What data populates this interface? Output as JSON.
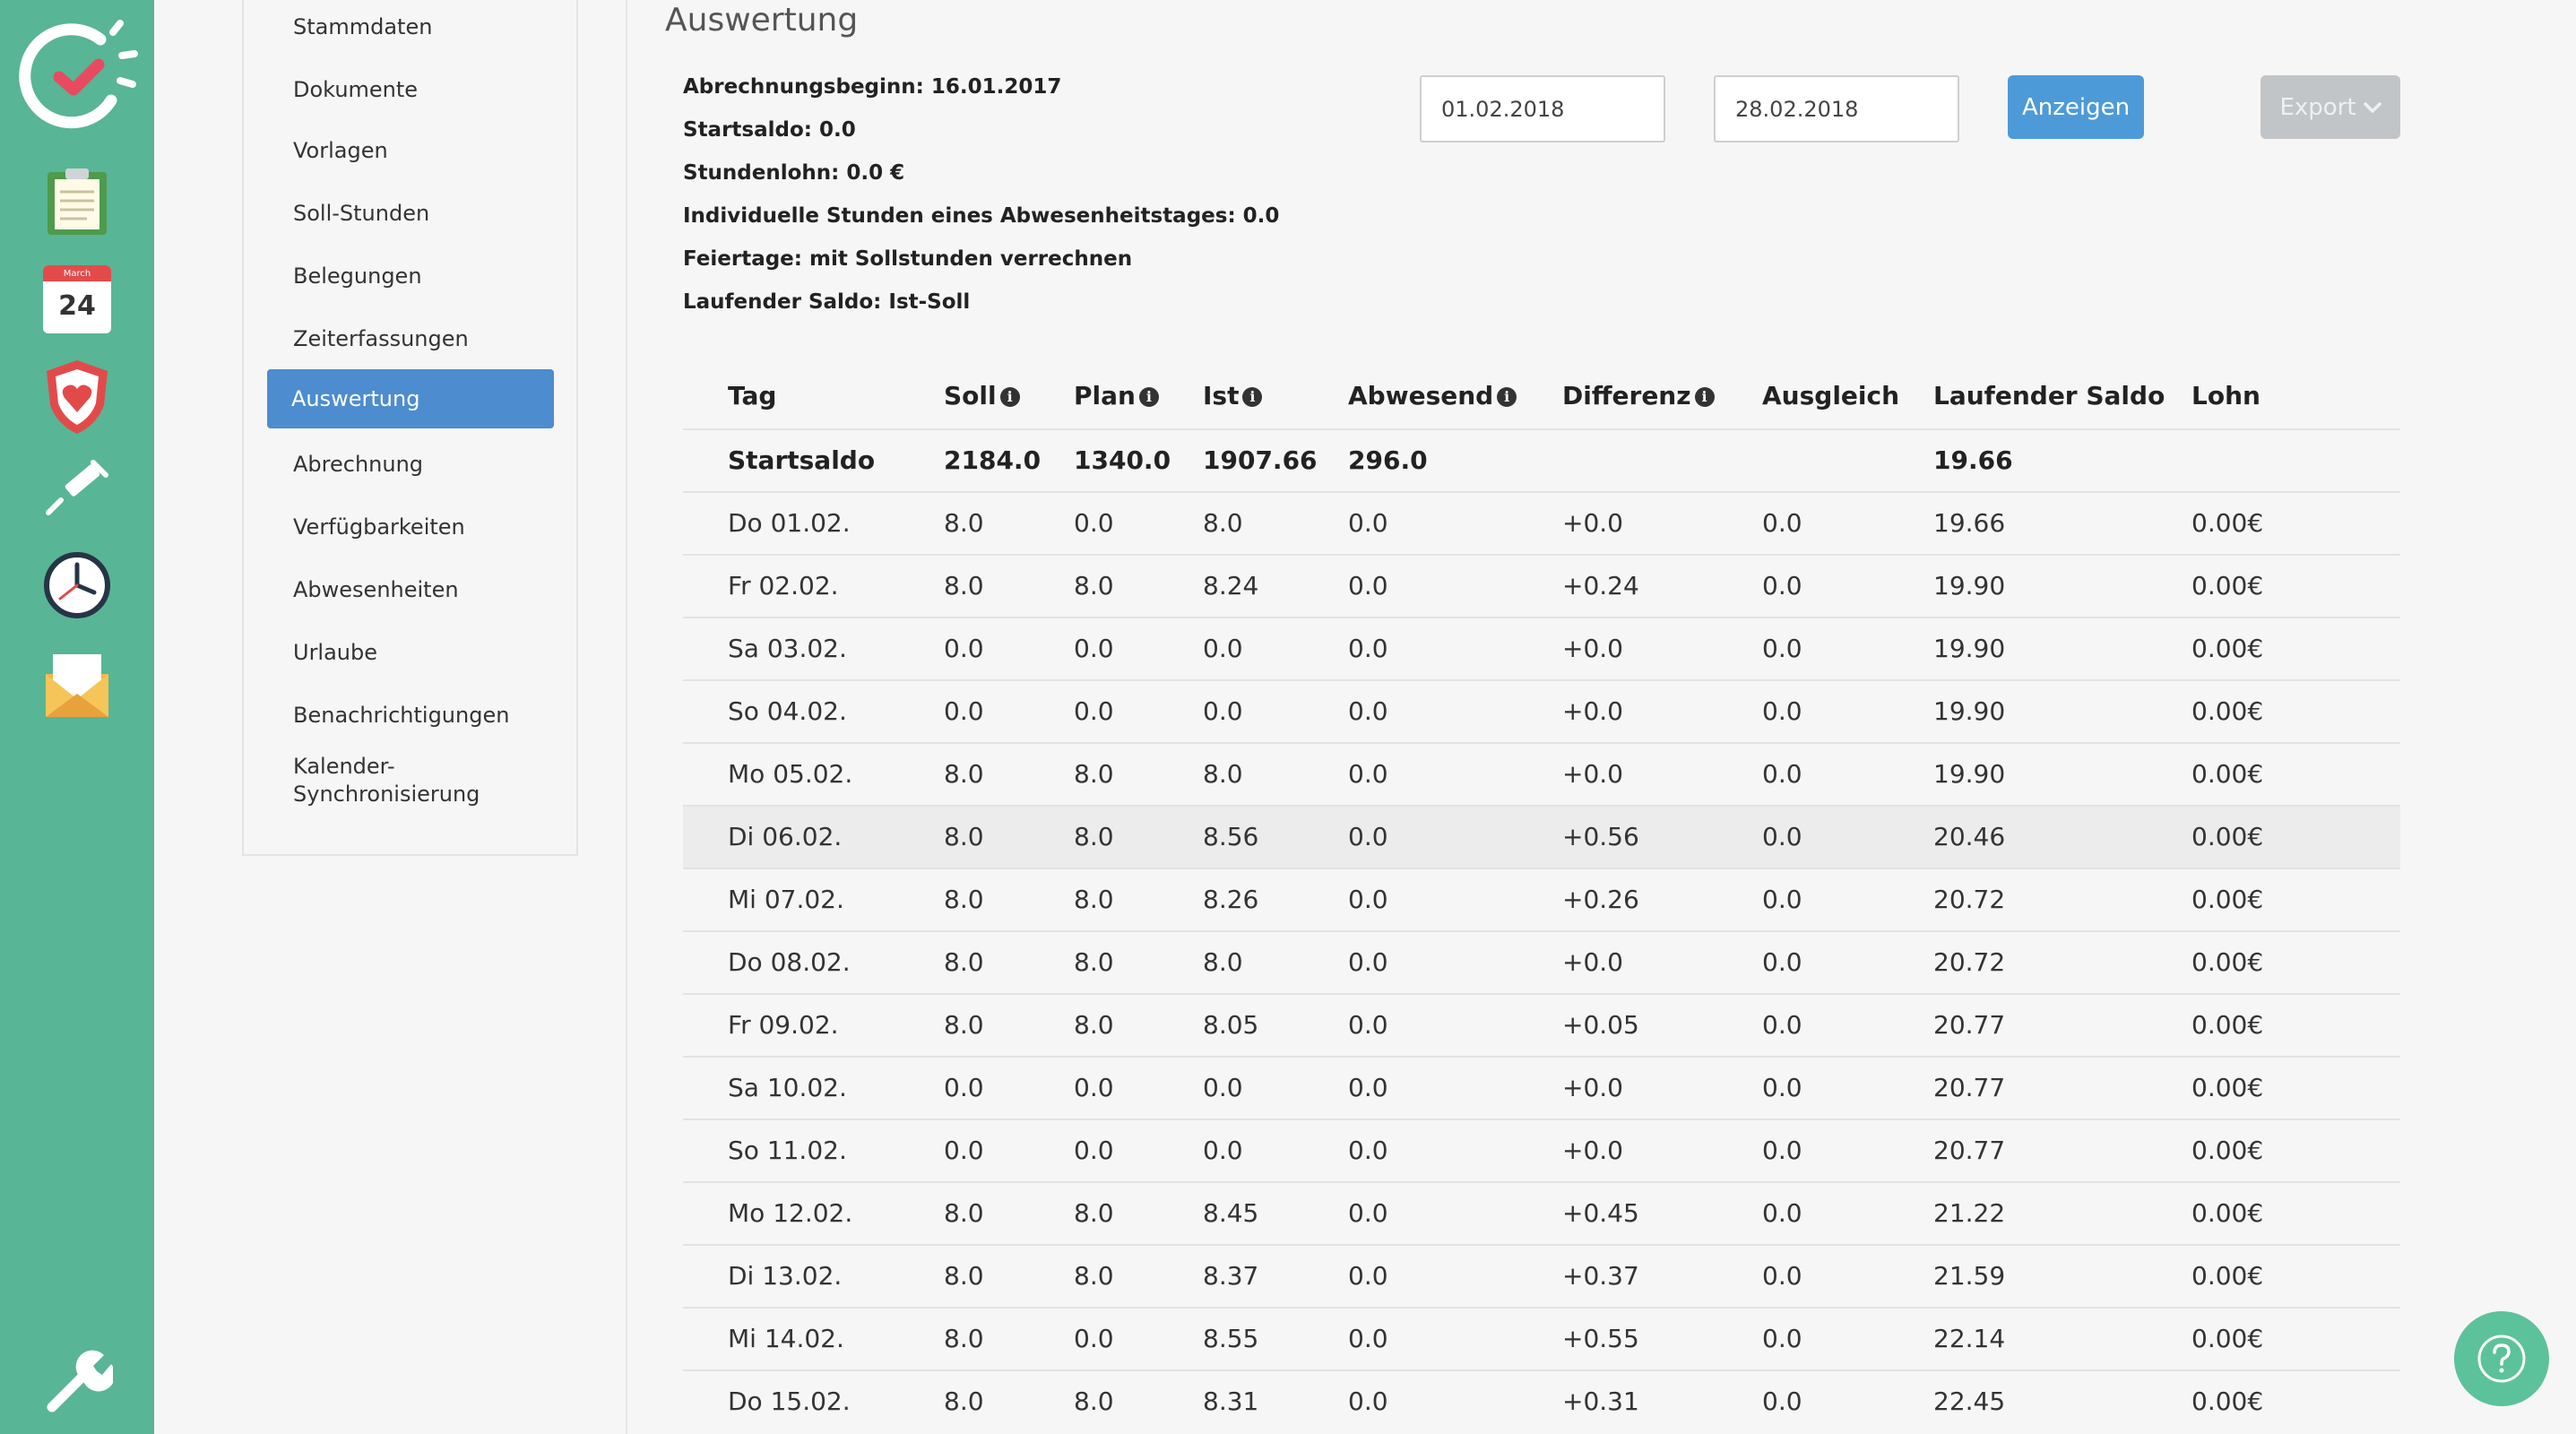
{
  "colors": {
    "rail": "#58b596",
    "accent": "#4d8cce",
    "button": "#4d9ad8",
    "export_disabled": "#c2c5c8"
  },
  "rail_icons": [
    "app-logo-icon",
    "clipboard-icon",
    "calendar-icon",
    "shield-heart-icon",
    "syringe-icon",
    "clock-icon",
    "envelope-icon",
    "wrench-icon"
  ],
  "calendar_icon": {
    "month": "March",
    "day": "24"
  },
  "subnav": {
    "items": [
      {
        "label": "Stammdaten"
      },
      {
        "label": "Dokumente"
      },
      {
        "label": "Vorlagen"
      },
      {
        "label": "Soll-Stunden"
      },
      {
        "label": "Belegungen"
      },
      {
        "label": "Zeiterfassungen"
      },
      {
        "label": "Auswertung",
        "active": true
      },
      {
        "label": "Abrechnung"
      },
      {
        "label": "Verfügbarkeiten"
      },
      {
        "label": "Abwesenheiten"
      },
      {
        "label": "Urlaube"
      },
      {
        "label": "Benachrichtigungen"
      },
      {
        "label": "Kalender-\nSynchronisierung"
      }
    ]
  },
  "page": {
    "title": "Auswertung",
    "info": [
      "Abrechnungsbeginn: 16.01.2017",
      "Startsaldo: 0.0",
      "Stundenlohn: 0.0 €",
      "Individuelle Stunden eines Abwesenheitstages: 0.0",
      "Feiertage: mit Sollstunden verrechnen",
      "Laufender Saldo: Ist-Soll"
    ],
    "date_from": "01.02.2018",
    "date_to": "28.02.2018",
    "show_button": "Anzeigen",
    "export_button": "Export"
  },
  "table": {
    "headers": [
      {
        "label": "Tag",
        "info": false
      },
      {
        "label": "Soll",
        "info": true
      },
      {
        "label": "Plan",
        "info": true
      },
      {
        "label": "Ist",
        "info": true
      },
      {
        "label": "Abwesend",
        "info": true
      },
      {
        "label": "Differenz",
        "info": true
      },
      {
        "label": "Ausgleich",
        "info": false
      },
      {
        "label": "Laufender Saldo",
        "info": false
      },
      {
        "label": "Lohn",
        "info": false
      }
    ],
    "start_row": [
      "Startsaldo",
      "2184.0",
      "1340.0",
      "1907.66",
      "296.0",
      "",
      "",
      "19.66",
      ""
    ],
    "rows": [
      [
        "Do 01.02.",
        "8.0",
        "0.0",
        "8.0",
        "0.0",
        "+0.0",
        "0.0",
        "19.66",
        "0.00€"
      ],
      [
        "Fr 02.02.",
        "8.0",
        "8.0",
        "8.24",
        "0.0",
        "+0.24",
        "0.0",
        "19.90",
        "0.00€"
      ],
      [
        "Sa 03.02.",
        "0.0",
        "0.0",
        "0.0",
        "0.0",
        "+0.0",
        "0.0",
        "19.90",
        "0.00€"
      ],
      [
        "So 04.02.",
        "0.0",
        "0.0",
        "0.0",
        "0.0",
        "+0.0",
        "0.0",
        "19.90",
        "0.00€"
      ],
      [
        "Mo 05.02.",
        "8.0",
        "8.0",
        "8.0",
        "0.0",
        "+0.0",
        "0.0",
        "19.90",
        "0.00€"
      ],
      [
        "Di 06.02.",
        "8.0",
        "8.0",
        "8.56",
        "0.0",
        "+0.56",
        "0.0",
        "20.46",
        "0.00€"
      ],
      [
        "Mi 07.02.",
        "8.0",
        "8.0",
        "8.26",
        "0.0",
        "+0.26",
        "0.0",
        "20.72",
        "0.00€"
      ],
      [
        "Do 08.02.",
        "8.0",
        "8.0",
        "8.0",
        "0.0",
        "+0.0",
        "0.0",
        "20.72",
        "0.00€"
      ],
      [
        "Fr 09.02.",
        "8.0",
        "8.0",
        "8.05",
        "0.0",
        "+0.05",
        "0.0",
        "20.77",
        "0.00€"
      ],
      [
        "Sa 10.02.",
        "0.0",
        "0.0",
        "0.0",
        "0.0",
        "+0.0",
        "0.0",
        "20.77",
        "0.00€"
      ],
      [
        "So 11.02.",
        "0.0",
        "0.0",
        "0.0",
        "0.0",
        "+0.0",
        "0.0",
        "20.77",
        "0.00€"
      ],
      [
        "Mo 12.02.",
        "8.0",
        "8.0",
        "8.45",
        "0.0",
        "+0.45",
        "0.0",
        "21.22",
        "0.00€"
      ],
      [
        "Di 13.02.",
        "8.0",
        "8.0",
        "8.37",
        "0.0",
        "+0.37",
        "0.0",
        "21.59",
        "0.00€"
      ],
      [
        "Mi 14.02.",
        "8.0",
        "0.0",
        "8.55",
        "0.0",
        "+0.55",
        "0.0",
        "22.14",
        "0.00€"
      ],
      [
        "Do 15.02.",
        "8.0",
        "8.0",
        "8.31",
        "0.0",
        "+0.31",
        "0.0",
        "22.45",
        "0.00€"
      ]
    ],
    "highlighted_row": 5
  }
}
